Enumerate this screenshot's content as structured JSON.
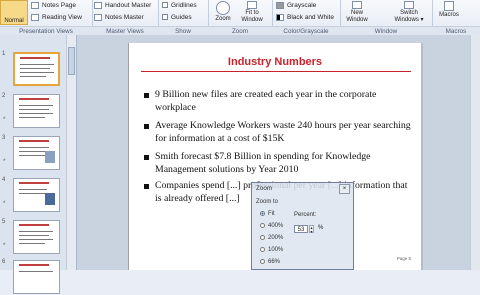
{
  "ribbon": {
    "normal_label": "Normal",
    "notes_page": "Notes Page",
    "reading_view": "Reading View",
    "handout_master": "Handout Master",
    "notes_master": "Notes Master",
    "gridlines": "Gridlines",
    "guides": "Guides",
    "zoom": "Zoom",
    "fit_to_window_line1": "Fit to",
    "fit_to_window_line2": "Window",
    "grayscale": "Grayscale",
    "black_and_white": "Black and White",
    "new_window_line1": "New",
    "new_window_line2": "Window",
    "switch_windows_line1": "Switch",
    "switch_windows_line2": "Windows",
    "macros": "Macros",
    "groups": [
      "Presentation Views",
      "Master Views",
      "Show",
      "Zoom",
      "Color/Grayscale",
      "Window",
      "Macros"
    ]
  },
  "slides_panel": {
    "numbers": [
      "1",
      "2",
      "3",
      "4",
      "5",
      "6"
    ],
    "star": "*"
  },
  "slide": {
    "title": "Industry Numbers",
    "bullets": [
      "9 Billion new files are created each year in the corporate workplace",
      "Average Knowledge Workers waste 240 hours per year searching for information at a cost of $15K",
      "Smith forecast $7.8 Billion in spending for Knowledge Management solutions by Year 2010",
      "Companies spend [...] professional per year [...] information that is already offered [...]"
    ],
    "page_label": "Page 5"
  },
  "zoom_dialog": {
    "title": "Zoom",
    "close": "×",
    "zoom_to_label": "Zoom to",
    "options": [
      "Fit",
      "400%",
      "200%",
      "100%",
      "66%"
    ],
    "percent_label": "Percent:",
    "percent_value": "53",
    "percent_sign": "%"
  },
  "colors": {
    "title_red": "#c8232c",
    "ribbon_bg": "#e4eaf3",
    "selected_thumb": "#e8a43c"
  }
}
